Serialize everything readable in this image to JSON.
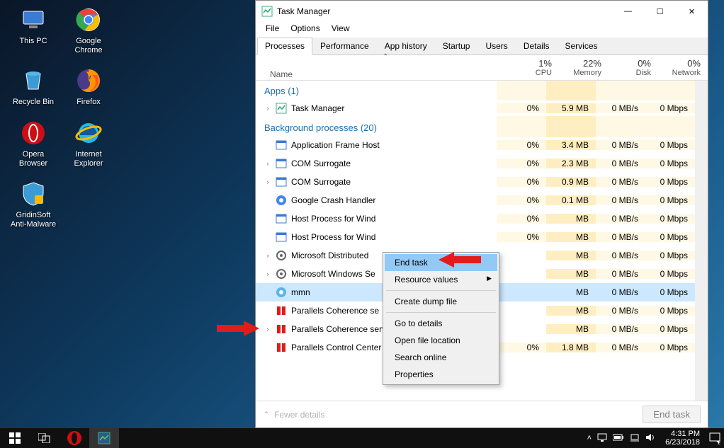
{
  "desktop": {
    "icons": [
      {
        "name": "this-pc",
        "label": "This PC"
      },
      {
        "name": "google-chrome",
        "label": "Google\nChrome"
      },
      {
        "name": "recycle-bin",
        "label": "Recycle Bin"
      },
      {
        "name": "firefox",
        "label": "Firefox"
      },
      {
        "name": "opera-browser",
        "label": "Opera\nBrowser"
      },
      {
        "name": "internet-explorer",
        "label": "Internet\nExplorer"
      },
      {
        "name": "gridinsoft-anti-malware",
        "label": "GridinSoft\nAnti-Malware"
      }
    ]
  },
  "taskmgr": {
    "title": "Task Manager",
    "menus": [
      "File",
      "Options",
      "View"
    ],
    "tabs": [
      "Processes",
      "Performance",
      "App history",
      "Startup",
      "Users",
      "Details",
      "Services"
    ],
    "active_tab": 0,
    "columns": {
      "name": "Name",
      "stats": [
        {
          "pct": "1%",
          "label": "CPU"
        },
        {
          "pct": "22%",
          "label": "Memory"
        },
        {
          "pct": "0%",
          "label": "Disk"
        },
        {
          "pct": "0%",
          "label": "Network"
        }
      ]
    },
    "groups": [
      {
        "title": "Apps (1)",
        "rows": [
          {
            "expand": true,
            "icon": "taskmgr",
            "name": "Task Manager",
            "cpu": "0%",
            "mem": "5.9 MB",
            "disk": "0 MB/s",
            "net": "0 Mbps"
          }
        ]
      },
      {
        "title": "Background processes (20)",
        "rows": [
          {
            "expand": false,
            "icon": "app",
            "name": "Application Frame Host",
            "cpu": "0%",
            "mem": "3.4 MB",
            "disk": "0 MB/s",
            "net": "0 Mbps"
          },
          {
            "expand": true,
            "icon": "app",
            "name": "COM Surrogate",
            "cpu": "0%",
            "mem": "2.3 MB",
            "disk": "0 MB/s",
            "net": "0 Mbps"
          },
          {
            "expand": true,
            "icon": "app",
            "name": "COM Surrogate",
            "cpu": "0%",
            "mem": "0.9 MB",
            "disk": "0 MB/s",
            "net": "0 Mbps"
          },
          {
            "expand": false,
            "icon": "chrome",
            "name": "Google Crash Handler",
            "cpu": "0%",
            "mem": "0.1 MB",
            "disk": "0 MB/s",
            "net": "0 Mbps"
          },
          {
            "expand": false,
            "icon": "app",
            "name": "Host Process for Wind",
            "cpu": "0%",
            "mem": "MB",
            "disk": "0 MB/s",
            "net": "0 Mbps"
          },
          {
            "expand": false,
            "icon": "app",
            "name": "Host Process for Wind",
            "cpu": "0%",
            "mem": "MB",
            "disk": "0 MB/s",
            "net": "0 Mbps"
          },
          {
            "expand": true,
            "icon": "svc",
            "name": "Microsoft Distributed",
            "cpu": "",
            "mem": "MB",
            "disk": "0 MB/s",
            "net": "0 Mbps"
          },
          {
            "expand": true,
            "icon": "svc",
            "name": "Microsoft Windows Se",
            "cpu": "",
            "mem": "MB",
            "disk": "0 MB/s",
            "net": "0 Mbps"
          },
          {
            "expand": false,
            "icon": "mmn",
            "name": "mmn",
            "cpu": "",
            "mem": "MB",
            "disk": "0 MB/s",
            "net": "0 Mbps",
            "selected": true
          },
          {
            "expand": false,
            "icon": "par",
            "name": "Parallels Coherence se",
            "cpu": "",
            "mem": "MB",
            "disk": "0 MB/s",
            "net": "0 Mbps"
          },
          {
            "expand": true,
            "icon": "par",
            "name": "Parallels Coherence service",
            "cpu": "",
            "mem": "MB",
            "disk": "0 MB/s",
            "net": "0 Mbps"
          },
          {
            "expand": false,
            "icon": "parc",
            "name": "Parallels Control Center",
            "cpu": "0%",
            "mem": "1.8 MB",
            "disk": "0 MB/s",
            "net": "0 Mbps"
          }
        ]
      }
    ],
    "footer": {
      "fewer": "Fewer details",
      "end_task": "End task"
    }
  },
  "context_menu": {
    "items": [
      {
        "label": "End task",
        "hl": true
      },
      {
        "label": "Resource values",
        "sub": true
      },
      {
        "sep": true
      },
      {
        "label": "Create dump file"
      },
      {
        "sep": true
      },
      {
        "label": "Go to details"
      },
      {
        "label": "Open file location"
      },
      {
        "label": "Search online"
      },
      {
        "label": "Properties"
      }
    ]
  },
  "taskbar": {
    "time": "4:31 PM",
    "date": "6/23/2018",
    "notif_count": "2"
  }
}
